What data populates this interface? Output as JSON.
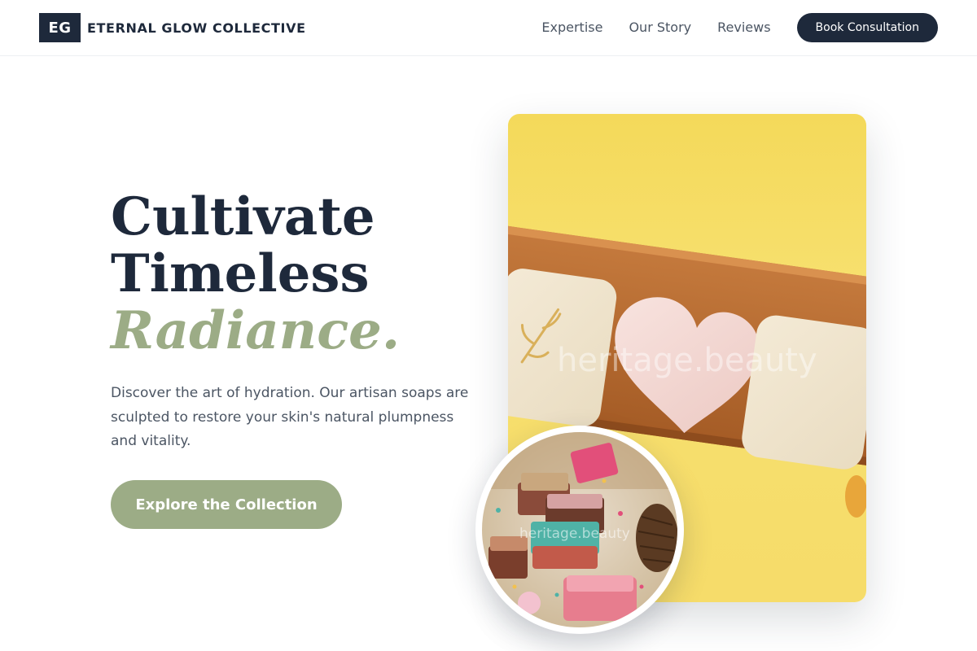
{
  "brand": {
    "mark": "EG",
    "name": "ETERNAL GLOW COLLECTIVE"
  },
  "nav": {
    "links": [
      "Expertise",
      "Our Story",
      "Reviews"
    ],
    "cta": "Book Consultation"
  },
  "hero": {
    "title_line1": "Cultivate",
    "title_line2": "Timeless",
    "title_accent": "Radiance.",
    "description": "Discover the art of hydration. Our artisan soaps are sculpted to restore your skin's natural plumpness and vitality.",
    "cta": "Explore the Collection"
  },
  "images": {
    "main_watermark": "heritage.beauty",
    "inset_watermark": "heritage.beauty"
  },
  "colors": {
    "navy": "#1e293b",
    "sage": "#9cac86",
    "text_muted": "#4b5563"
  }
}
